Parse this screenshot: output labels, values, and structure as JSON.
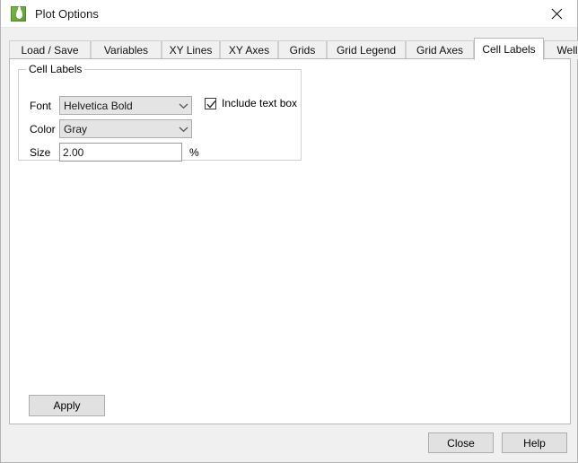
{
  "window": {
    "title": "Plot Options",
    "icon": "water-drop-icon",
    "close_label": "×",
    "accent_color": "#5e9c33"
  },
  "tabs": [
    {
      "label": "Load / Save",
      "selected": false
    },
    {
      "label": "Variables",
      "selected": false
    },
    {
      "label": "XY Lines",
      "selected": false
    },
    {
      "label": "XY Axes",
      "selected": false
    },
    {
      "label": "Grids",
      "selected": false
    },
    {
      "label": "Grid Legend",
      "selected": false
    },
    {
      "label": "Grid Axes",
      "selected": false
    },
    {
      "label": "Cell Labels",
      "selected": true
    },
    {
      "label": "Wells",
      "selected": false
    }
  ],
  "group": {
    "legend": "Cell Labels",
    "font": {
      "label": "Font",
      "value": "Helvetica Bold"
    },
    "color": {
      "label": "Color",
      "value": "Gray"
    },
    "size": {
      "label": "Size",
      "value": "2.00",
      "unit": "%"
    },
    "include_text_box": {
      "label": "Include text box",
      "checked": true
    }
  },
  "buttons": {
    "apply": "Apply",
    "close": "Close",
    "help": "Help"
  }
}
